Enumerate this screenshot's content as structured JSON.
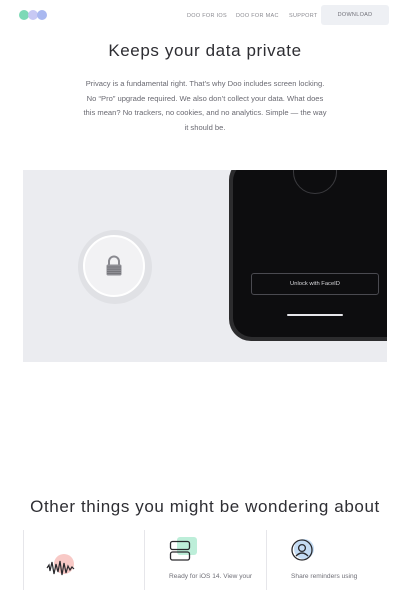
{
  "header": {
    "logo_alt": "Doo",
    "nav": [
      "DOO FOR IOS",
      "DOO FOR MAC",
      "SUPPORT"
    ],
    "download_label": "DOWNLOAD"
  },
  "privacy": {
    "title": "Keeps your data private",
    "body": "Privacy is a fundamental right. That’s why Doo includes screen locking. No “Pro” upgrade required. We also don’t collect your data. What does this mean? No trackers, no cookies, and no analytics. Simple — the way it should be.",
    "unlock_label": "Unlock with FaceID"
  },
  "other": {
    "title": "Other things you might be wondering about",
    "cards": [
      {
        "text": "",
        "icon": "waveform-icon"
      },
      {
        "text": "Ready for iOS 14. View your",
        "icon": "widget-stack-icon"
      },
      {
        "text": "Share reminders using",
        "icon": "user-circle-icon"
      }
    ]
  },
  "colors": {
    "logo_dot_1": "#7dd9b6",
    "logo_dot_2": "#c8c9f4",
    "logo_dot_3": "#a9b8f0",
    "panel_bg": "#ebecf0",
    "phone_body": "#2c2c2e"
  }
}
